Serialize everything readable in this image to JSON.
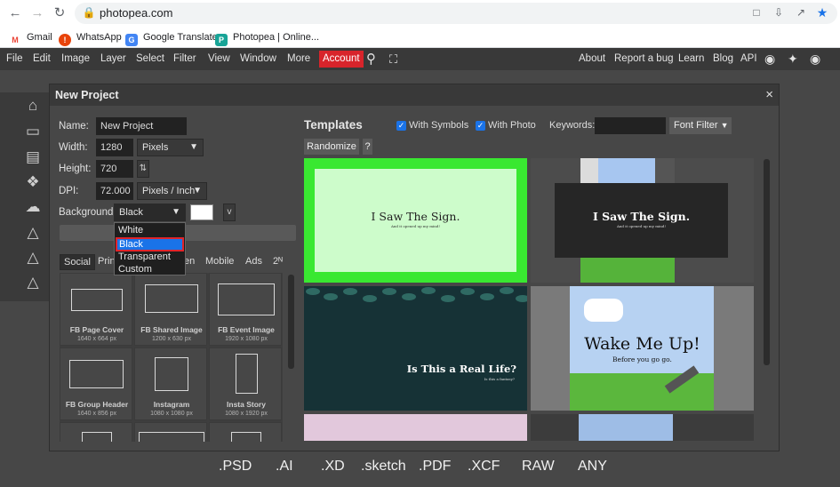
{
  "browser": {
    "url": "photopea.com",
    "bookmarks": [
      {
        "label": "Gmail",
        "icon": "gmail-icon",
        "color": "#ea4335",
        "glyph": "M"
      },
      {
        "label": "WhatsApp",
        "icon": "whatsapp-icon",
        "color": "#e8430a",
        "glyph": "!"
      },
      {
        "label": "Google Translate",
        "icon": "translate-icon",
        "color": "#4285f4",
        "glyph": "G"
      },
      {
        "label": "Photopea | Online...",
        "icon": "photopea-icon",
        "color": "#18a497",
        "glyph": "P"
      }
    ]
  },
  "menubar": {
    "items": [
      "File",
      "Edit",
      "Image",
      "Layer",
      "Select",
      "Filter",
      "View",
      "Window",
      "More"
    ],
    "account": "Account",
    "right_items": [
      "About",
      "Report a bug",
      "Learn",
      "Blog",
      "API"
    ]
  },
  "formats": [
    ".PSD",
    ".AI",
    ".XD",
    ".sketch",
    ".PDF",
    ".XCF",
    "RAW",
    "ANY"
  ],
  "dialog": {
    "title": "New Project",
    "close": "×",
    "name_label": "Name:",
    "name_value": "New Project",
    "width_label": "Width:",
    "width_value": "1280",
    "width_unit": "Pixels",
    "height_label": "Height:",
    "height_value": "720",
    "dpi_label": "DPI:",
    "dpi_value": "72.000",
    "dpi_unit": "Pixels / Inch",
    "background_label": "Background:",
    "background_value": "Black",
    "background_options": [
      "White",
      "Black",
      "Transparent",
      "Custom"
    ],
    "color_btn": "v",
    "tabs": [
      "Social",
      "Prin",
      "en",
      "Mobile",
      "Ads",
      "2ᴺ"
    ],
    "presets": [
      {
        "name": "FB Page Cover",
        "size": "1640 x 664 px"
      },
      {
        "name": "FB Shared Image",
        "size": "1200 x 630 px"
      },
      {
        "name": "FB Event Image",
        "size": "1920 x 1080 px"
      },
      {
        "name": "FB Group Header",
        "size": "1640 x 856 px"
      },
      {
        "name": "Instagram",
        "size": "1080 x 1080 px"
      },
      {
        "name": "Insta Story",
        "size": "1080 x 1920 px"
      }
    ],
    "templates": {
      "title": "Templates",
      "with_symbols": "With Symbols",
      "with_photo": "With Photo",
      "keywords_label": "Keywords:",
      "font_filter": "Font Filter",
      "randomize": "Randomize",
      "help": "?",
      "items": [
        {
          "title": "I Saw The Sign.",
          "subtitle": "And it opened up my mind!"
        },
        {
          "title": "I Saw The Sign.",
          "subtitle": "And it opened up my mind!"
        },
        {
          "title": "Is This a Real Life?",
          "subtitle": "Is this a fantasy?"
        },
        {
          "title": "Wake Me Up!",
          "subtitle": "Before you go go."
        }
      ]
    }
  },
  "colors": {
    "menubar_bg": "#393939",
    "account_bg": "#d8242b",
    "selection_blue": "#1a73e8",
    "highlight_red": "#e0242b",
    "template1_green": "#39e831",
    "template3_teal": "#163236"
  }
}
